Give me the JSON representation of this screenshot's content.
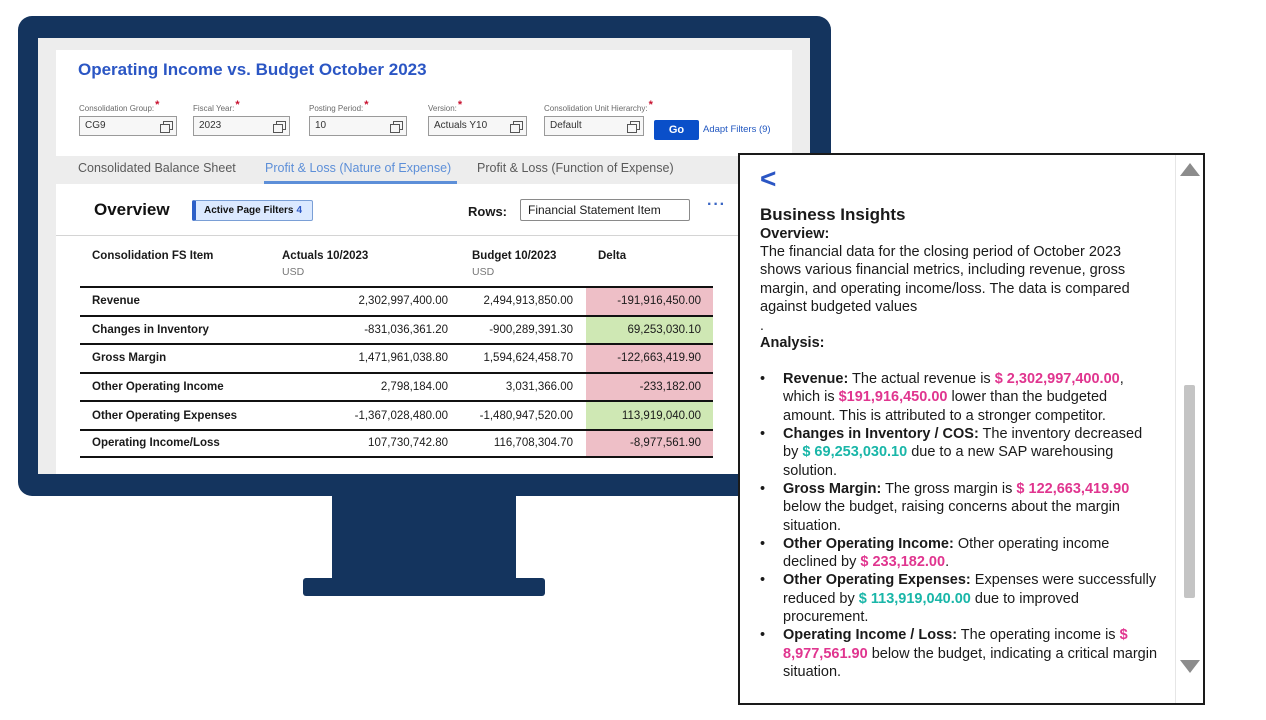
{
  "header": {
    "title": "Operating Income vs. Budget October 2023"
  },
  "filters": [
    {
      "label": "Consolidation Group:",
      "value": "CG9"
    },
    {
      "label": "Fiscal Year:",
      "value": "2023"
    },
    {
      "label": "Posting Period:",
      "value": "10"
    },
    {
      "label": "Version:",
      "value": "Actuals Y10"
    },
    {
      "label": "Consolidation Unit Hierarchy:",
      "value": "Default"
    }
  ],
  "required_marker": "*",
  "go_label": "Go",
  "adapt_filters_label": "Adapt Filters (9)",
  "tabs": [
    {
      "label": "Consolidated Balance Sheet",
      "active": false
    },
    {
      "label": "Profit & Loss (Nature of Expense)",
      "active": true
    },
    {
      "label": "Profit & Loss (Function of Expense)",
      "active": false
    }
  ],
  "overview": {
    "title": "Overview",
    "badge_label": "Active Page Filters",
    "badge_count": "4",
    "rows_label": "Rows:",
    "rows_value": "Financial Statement Item",
    "more_icon": "···"
  },
  "table": {
    "columns": [
      {
        "label": "Consolidation FS Item",
        "sub": ""
      },
      {
        "label": "Actuals 10/2023",
        "sub": "USD"
      },
      {
        "label": "Budget 10/2023",
        "sub": "USD"
      },
      {
        "label": "Delta",
        "sub": ""
      }
    ],
    "rows": [
      {
        "item": "Revenue",
        "actuals": "2,302,997,400.00",
        "budget": "2,494,913,850.00",
        "delta": "-191,916,450.00",
        "status": "neg"
      },
      {
        "item": "Changes in Inventory",
        "actuals": "-831,036,361.20",
        "budget": "-900,289,391.30",
        "delta": "69,253,030.10",
        "status": "pos"
      },
      {
        "item": "Gross Margin",
        "actuals": "1,471,961,038.80",
        "budget": "1,594,624,458.70",
        "delta": "-122,663,419.90",
        "status": "neg"
      },
      {
        "item": "Other Operating Income",
        "actuals": "2,798,184.00",
        "budget": "3,031,366.00",
        "delta": "-233,182.00",
        "status": "neg"
      },
      {
        "item": "Other Operating Expenses",
        "actuals": "-1,367,028,480.00",
        "budget": "-1,480,947,520.00",
        "delta": "113,919,040.00",
        "status": "pos"
      },
      {
        "item": "Operating Income/Loss",
        "actuals": "107,730,742.80",
        "budget": "116,708,304.70",
        "delta": "-8,977,561.90",
        "status": "neg"
      }
    ]
  },
  "insights": {
    "back_icon": "<",
    "title": "Business Insights",
    "overview_heading": "Overview:",
    "overview_text": "The financial data for the closing period of October 2023 shows various financial metrics, including revenue, gross margin, and operating income/loss. The data is compared against budgeted values",
    "period": ".",
    "analysis_heading": "Analysis:",
    "items": [
      {
        "term": "Revenue:",
        "parts": [
          {
            "t": " The actual revenue is ",
            "c": ""
          },
          {
            "t": "$ 2,302,997,400.00",
            "c": "pink"
          },
          {
            "t": ", which is ",
            "c": ""
          },
          {
            "t": "$191,916,450.00",
            "c": "pink"
          },
          {
            "t": " lower than the budgeted amount. This is attributed to a stronger competitor.",
            "c": ""
          }
        ]
      },
      {
        "term": "Changes in Inventory / COS:",
        "parts": [
          {
            "t": " The inventory decreased by ",
            "c": ""
          },
          {
            "t": "$ 69,253,030.10",
            "c": "teal"
          },
          {
            "t": " due to a new SAP warehousing solution.",
            "c": ""
          }
        ]
      },
      {
        "term": "Gross Margin:",
        "parts": [
          {
            "t": " The gross margin is ",
            "c": ""
          },
          {
            "t": "$ 122,663,419.90",
            "c": "pink"
          },
          {
            "t": " below the budget, raising concerns about the margin situation.",
            "c": ""
          }
        ]
      },
      {
        "term": "Other Operating Income:",
        "parts": [
          {
            "t": " Other operating income declined by ",
            "c": ""
          },
          {
            "t": "$ 233,182.00",
            "c": "pink"
          },
          {
            "t": ".",
            "c": ""
          }
        ]
      },
      {
        "term": "Other Operating Expenses:",
        "parts": [
          {
            "t": " Expenses were successfully reduced by ",
            "c": ""
          },
          {
            "t": "$ 113,919,040.00",
            "c": "teal"
          },
          {
            "t": " due to improved procurement.",
            "c": ""
          }
        ]
      },
      {
        "term": "Operating Income / Loss:",
        "parts": [
          {
            "t": " The operating income is ",
            "c": ""
          },
          {
            "t": "$ 8,977,561.90",
            "c": "pink"
          },
          {
            "t": " below the budget, indicating a critical margin situation.",
            "c": ""
          }
        ]
      }
    ]
  },
  "colors": {
    "monitor": "#14345e",
    "title_blue": "#2b56c4",
    "delta_negative": "#eebfc7",
    "delta_positive": "#cfe8b4",
    "highlight_pink": "#e0358f",
    "highlight_teal": "#19b6a8"
  }
}
